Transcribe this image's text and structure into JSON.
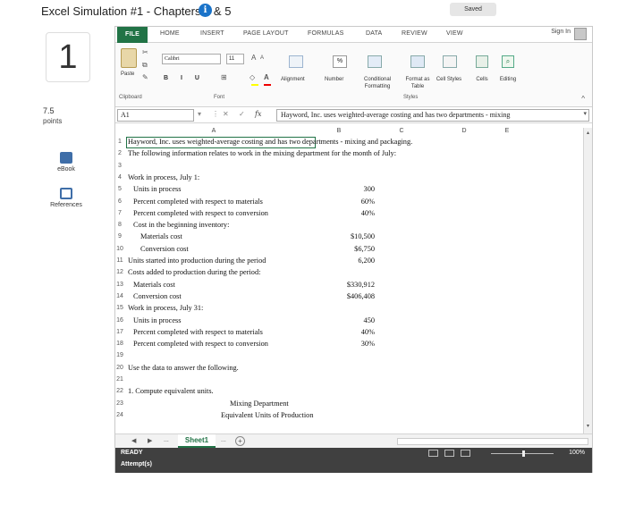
{
  "header": {
    "title": "Excel Simulation #1 - Chapters 4 & 5",
    "saved": "Saved"
  },
  "question": {
    "number": "1",
    "points_value": "7.5",
    "points_label": "points",
    "ebook_label": "eBook",
    "references_label": "References"
  },
  "ribbon": {
    "tabs": [
      "FILE",
      "HOME",
      "INSERT",
      "PAGE LAYOUT",
      "FORMULAS",
      "DATA",
      "REVIEW",
      "VIEW"
    ],
    "sign_in": "Sign In",
    "paste_label": "Paste",
    "font_name": "Calibri",
    "font_size": "11",
    "format_buttons": "B I U",
    "alignment_label": "Alignment",
    "number_label": "Number",
    "number_symbol": "%",
    "cond_format_label": "Conditional Formatting",
    "format_table_label": "Format as Table",
    "cell_styles_label": "Cell Styles",
    "cells_label": "Cells",
    "editing_label": "Editing",
    "group_clipboard": "Clipboard",
    "group_font": "Font",
    "group_styles": "Styles"
  },
  "formula_bar": {
    "cell_ref": "A1",
    "fx": "fx",
    "content": "Hayword, Inc. uses weighted-average costing and has two departments - mixing"
  },
  "columns": [
    "A",
    "B",
    "C",
    "D",
    "E"
  ],
  "rows": [
    {
      "n": "1",
      "text": "Hayword, Inc. uses weighted-average costing and has two departments - mixing and packaging.",
      "value": ""
    },
    {
      "n": "2",
      "text": "The following information relates to work in the mixing department for the month of July:",
      "value": ""
    },
    {
      "n": "3",
      "text": "",
      "value": ""
    },
    {
      "n": "4",
      "text": "Work in process, July 1:",
      "value": ""
    },
    {
      "n": "5",
      "text": "Units in process",
      "value": "300"
    },
    {
      "n": "6",
      "text": "Percent completed with respect to materials",
      "value": "60%"
    },
    {
      "n": "7",
      "text": "Percent completed with respect to conversion",
      "value": "40%"
    },
    {
      "n": "8",
      "text": "Cost in the beginning inventory:",
      "value": ""
    },
    {
      "n": "9",
      "text": "Materials cost",
      "value": "$10,500"
    },
    {
      "n": "10",
      "text": "Conversion cost",
      "value": "$6,750"
    },
    {
      "n": "11",
      "text": "Units started into production during the period",
      "value": "6,200"
    },
    {
      "n": "12",
      "text": "Costs added to production during the period:",
      "value": ""
    },
    {
      "n": "13",
      "text": "Materials cost",
      "value": "$330,912"
    },
    {
      "n": "14",
      "text": "Conversion cost",
      "value": "$406,408"
    },
    {
      "n": "15",
      "text": "Work in process, July 31:",
      "value": ""
    },
    {
      "n": "16",
      "text": "Units in process",
      "value": "450"
    },
    {
      "n": "17",
      "text": "Percent completed with respect to materials",
      "value": "40%"
    },
    {
      "n": "18",
      "text": "Percent completed with respect to conversion",
      "value": "30%"
    },
    {
      "n": "19",
      "text": "",
      "value": ""
    },
    {
      "n": "20",
      "text": "Use the data to answer the following.",
      "value": ""
    },
    {
      "n": "21",
      "text": "",
      "value": ""
    },
    {
      "n": "22",
      "text": "1. Compute equivalent units.",
      "value": ""
    },
    {
      "n": "23",
      "text": "Mixing Department",
      "value": ""
    },
    {
      "n": "24",
      "text": "Equivalent Units of Production",
      "value": ""
    }
  ],
  "sheet": {
    "tab_name": "Sheet1",
    "ellipsis": "..."
  },
  "status": {
    "ready": "READY",
    "zoom": "100%",
    "attempts": "Attempt(s)"
  }
}
